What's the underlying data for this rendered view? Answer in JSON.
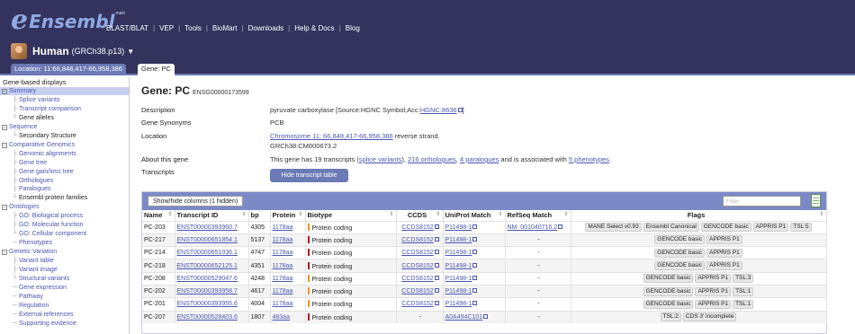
{
  "header": {
    "logo_e": "e",
    "logo_word": "Ensembl",
    "logo_sup": "main",
    "nav": [
      "BLAST/BLAT",
      "VEP",
      "Tools",
      "BioMart",
      "Downloads",
      "Help & Docs",
      "Blog"
    ],
    "species_name": "Human",
    "assembly": "(GRCh38.p13)",
    "caret": "▼"
  },
  "tabs": {
    "location": "Location: 11:66,848,417-66,958,386",
    "gene": "Gene: PC"
  },
  "sidebar": {
    "title": "Gene-based displays",
    "items": [
      {
        "label": "Summary",
        "box": "⊟",
        "sel": true
      },
      {
        "label": "Splice variants",
        "tree": "├"
      },
      {
        "label": "Transcript comparison",
        "tree": "├"
      },
      {
        "label": "Gene alleles",
        "tree": "└",
        "plain": true
      },
      {
        "label": "Sequence",
        "box": "⊟"
      },
      {
        "label": "Secondary Structure",
        "tree": "└",
        "plain": true
      },
      {
        "label": "Comparative Genomics",
        "box": "⊟"
      },
      {
        "label": "Genomic alignments",
        "tree": "├"
      },
      {
        "label": "Gene tree",
        "tree": "├"
      },
      {
        "label": "Gene gain/loss tree",
        "tree": "├"
      },
      {
        "label": "Orthologues",
        "tree": "├"
      },
      {
        "label": "Paralogues",
        "tree": "├"
      },
      {
        "label": "Ensembl protein families",
        "tree": "└",
        "plain": true
      },
      {
        "label": "Ontologies",
        "box": "⊟"
      },
      {
        "label": "GO: Biological process",
        "tree": "├"
      },
      {
        "label": "GO: Molecular function",
        "tree": "├"
      },
      {
        "label": "GO: Cellular component",
        "tree": "└"
      },
      {
        "label": "Phenotypes",
        "tree": "─"
      },
      {
        "label": "Genetic Variation",
        "box": "⊟"
      },
      {
        "label": "Variant table",
        "tree": "├"
      },
      {
        "label": "Variant image",
        "tree": "├"
      },
      {
        "label": "Structural variants",
        "tree": "└"
      },
      {
        "label": "Gene expression",
        "tree": "─"
      },
      {
        "label": "Pathway",
        "tree": "─"
      },
      {
        "label": "Regulation",
        "tree": "─"
      },
      {
        "label": "External references",
        "tree": "─"
      },
      {
        "label": "Supporting evidence",
        "tree": "─"
      }
    ]
  },
  "gene": {
    "title": "Gene: PC",
    "id": "ENSG00000173599",
    "labels": {
      "description": "Description",
      "synonyms": "Gene Synonyms",
      "location": "Location",
      "about": "About this gene",
      "transcripts": "Transcripts"
    },
    "description_text": "pyruvate carboxylase [Source:HGNC Symbol;Acc:",
    "description_link": "HGNC:8636",
    "description_end": "]",
    "synonyms": "PCB",
    "location_link": "Chromosome 11: 66,848,417-66,958,386",
    "location_strand": " reverse strand.",
    "location_sub": "GRCh38:CM000673.2",
    "about_pre": "This gene has 19 transcripts (",
    "about_splice": "splice variants",
    "about_mid1": "), ",
    "about_ortho": "216 orthologues",
    "about_mid2": ", ",
    "about_para": "4 paralogues",
    "about_mid3": " and is associated with ",
    "about_pheno": "5 phenotypes",
    "about_end": ".",
    "hide_button": "Hide transcript table"
  },
  "table": {
    "show_hide": "Show/hide columns (1 hidden)",
    "filter_placeholder": "Filter",
    "columns": [
      "Name",
      "Transcript ID",
      "bp",
      "Protein",
      "Biotype",
      "CCDS",
      "UniProt Match",
      "RefSeq Match",
      "Flags"
    ],
    "rows": [
      {
        "name": "PC-203",
        "tid": "ENST00000393960.7",
        "bp": "4305",
        "protein": "1178aa",
        "biotype": "Protein coding",
        "bio_color": "#e69a20",
        "ccds": "CCDS8152",
        "uniprot": "P11498-1",
        "refseq": "NM_001040716.2",
        "flags": [
          "MANE Select v0.93",
          "Ensembl Canonical",
          "GENCODE basic",
          "APPRIS P1",
          "TSL:5"
        ]
      },
      {
        "name": "PC-217",
        "tid": "ENST00000651854.1",
        "bp": "5137",
        "protein": "1178aa",
        "biotype": "Protein coding",
        "bio_color": "#b0191e",
        "ccds": "CCDS8152",
        "uniprot": "P11498-1",
        "refseq": "-",
        "flags": [
          "GENCODE basic",
          "APPRIS P1"
        ]
      },
      {
        "name": "PC-214",
        "tid": "ENST00000651036.1",
        "bp": "4747",
        "protein": "1178aa",
        "biotype": "Protein coding",
        "bio_color": "#b0191e",
        "ccds": "CCDS8152",
        "uniprot": "P11498-1",
        "refseq": "-",
        "flags": [
          "GENCODE basic",
          "APPRIS P1"
        ]
      },
      {
        "name": "PC-218",
        "tid": "ENST00000652125.1",
        "bp": "4351",
        "protein": "1178aa",
        "biotype": "Protein coding",
        "bio_color": "#b0191e",
        "ccds": "CCDS8152",
        "uniprot": "P11498-1",
        "refseq": "-",
        "flags": [
          "GENCODE basic",
          "APPRIS P1"
        ]
      },
      {
        "name": "PC-208",
        "tid": "ENST00000529047.6",
        "bp": "4248",
        "protein": "1178aa",
        "biotype": "Protein coding",
        "bio_color": "#e69a20",
        "ccds": "CCDS8152",
        "uniprot": "P11498-1",
        "refseq": "-",
        "flags": [
          "GENCODE basic",
          "APPRIS P1",
          "TSL:3"
        ]
      },
      {
        "name": "PC-202",
        "tid": "ENST00000393958.7",
        "bp": "4617",
        "protein": "1178aa",
        "biotype": "Protein coding",
        "bio_color": "#e69a20",
        "ccds": "CCDS8152",
        "uniprot": "P11498-1",
        "refseq": "-",
        "flags": [
          "GENCODE basic",
          "APPRIS P1",
          "TSL:1"
        ]
      },
      {
        "name": "PC-201",
        "tid": "ENST00000393955.6",
        "bp": "4004",
        "protein": "1178aa",
        "biotype": "Protein coding",
        "bio_color": "#e69a20",
        "ccds": "CCDS8152",
        "uniprot": "P11498-1",
        "refseq": "-",
        "flags": [
          "GENCODE basic",
          "APPRIS P1",
          "TSL:1"
        ]
      },
      {
        "name": "PC-207",
        "tid": "ENST00000528403.6",
        "bp": "1807",
        "protein": "483aa",
        "biotype": "Protein coding",
        "bio_color": "#b0191e",
        "ccds": "-",
        "uniprot": "A0A494C101",
        "refseq": "-",
        "flags": [
          "TSL:2",
          "CDS 3' incomplete"
        ]
      }
    ]
  }
}
